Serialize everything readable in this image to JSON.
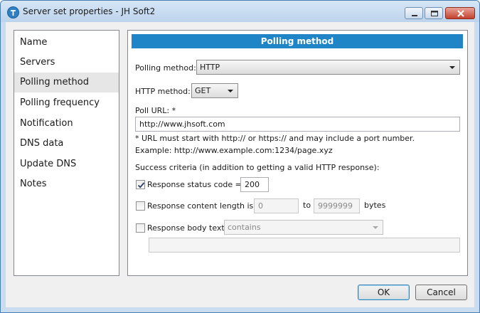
{
  "window": {
    "title": "Server set properties - JH Soft2"
  },
  "nav": {
    "items": [
      {
        "label": "Name"
      },
      {
        "label": "Servers"
      },
      {
        "label": "Polling method",
        "selected": true
      },
      {
        "label": "Polling frequency"
      },
      {
        "label": "Notification"
      },
      {
        "label": "DNS data"
      },
      {
        "label": "Update DNS"
      },
      {
        "label": "Notes"
      }
    ]
  },
  "panel": {
    "header": "Polling method",
    "polling_method": {
      "label": "Polling method:",
      "value": "HTTP"
    },
    "http_method": {
      "label": "HTTP method:",
      "value": "GET"
    },
    "poll_url": {
      "label": "Poll URL: *",
      "value": "http://www.jhsoft.com",
      "hint_line1": "* URL must start with http:// or https:// and may include a port number.",
      "hint_line2": "Example: http://www.example.com:1234/page.xyz"
    },
    "success_criteria_label": "Success criteria (in addition to getting a valid HTTP response):",
    "status_code": {
      "label": "Response status code =",
      "checked": true,
      "value": "200"
    },
    "content_length": {
      "label": "Response content length is",
      "checked": false,
      "from": "0",
      "to_label": "to",
      "to": "9999999",
      "unit": "bytes"
    },
    "body_text": {
      "label": "Response body text",
      "checked": false,
      "operator": "contains",
      "value": ""
    }
  },
  "buttons": {
    "ok": "OK",
    "cancel": "Cancel"
  },
  "colors": {
    "header_bg": "#1f85c7",
    "nav_selected_bg": "#e6e6e6",
    "window_frame": "#c9dcf0"
  }
}
